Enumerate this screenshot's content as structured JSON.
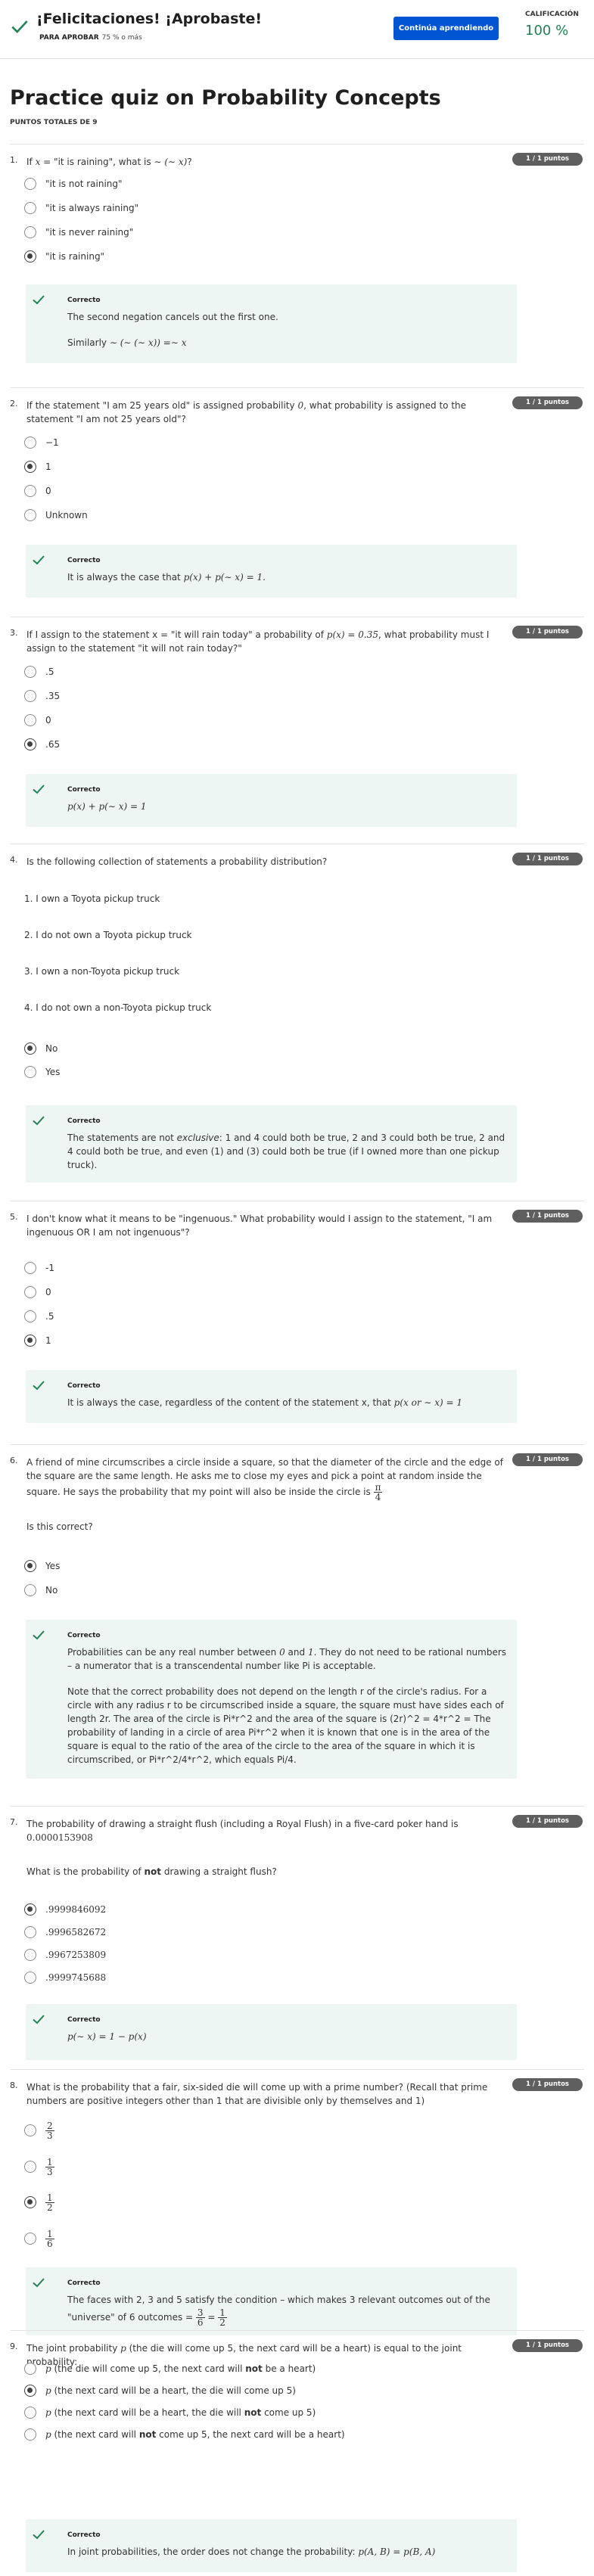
{
  "header": {
    "title": "¡Felicitaciones! ¡Aprobaste!",
    "pass_label": "PARA APROBAR",
    "pass_value": "75 % o más",
    "continue_button": "Continúa aprendiendo",
    "grade_label": "CALIFICACIÓN",
    "grade_value": "100 %"
  },
  "page": {
    "title": "Practice quiz on Probability Concepts",
    "total_points": "PUNTOS TOTALES DE 9"
  },
  "badge": "1 / 1 puntos",
  "correct_label": "Correcto",
  "questions": [
    {
      "number": "1.",
      "parts": [
        "If ",
        "x",
        " = \"it is raining\", what is ",
        "∼ (∼ x)",
        "?"
      ],
      "options": [
        "\"it is not raining\"",
        "\"it is always raining\"",
        "\"it is never raining\"",
        "\"it is raining\""
      ],
      "selected": 3,
      "feedback": "The second negation cancels out the first one.",
      "feedback2_pre": "Similarly",
      "feedback2_math": "∼ (∼ (∼ x)) =∼ x"
    },
    {
      "number": "2.",
      "parts": [
        "If the statement \"I am 25 years old\" is assigned probability ",
        "0",
        ", what probability is assigned to the statement \"I am not 25 years old\"?"
      ],
      "options": [
        "−1",
        "1",
        "0",
        "Unknown"
      ],
      "selected": 1,
      "feedback_pre": "It is always the case that ",
      "feedback_math": "p(x) + p(∼ x) = 1."
    },
    {
      "number": "3.",
      "parts": [
        "If I assign to the statement x = \"it will rain today\" a probability of ",
        "p(x) = 0.35",
        ", what probability must I assign to the statement \"it will not rain today?\""
      ],
      "options": [
        ".5",
        ".35",
        "0",
        ".65"
      ],
      "selected": 3,
      "feedback_math": "p(x) + p(∼ x) = 1"
    },
    {
      "number": "4.",
      "text": "Is the following collection of statements a probability distribution?",
      "statements": [
        "1. I own a Toyota pickup truck",
        "2. I do not own a Toyota pickup truck",
        "3. I own a non-Toyota pickup truck",
        "4. I do not own a non-Toyota pickup truck"
      ],
      "options": [
        "No",
        "Yes"
      ],
      "selected": 0,
      "fb_a": "The statements are not ",
      "fb_em": "exclusive",
      "fb_b": ": 1 and 4 could both be true, 2 and 3 could both be true, 2 and 4 could both be true, and even (1) and (3) could both be true (if I owned more than one pickup truck)."
    },
    {
      "number": "5.",
      "text": "I don't know what it means to be \"ingenuous.\" What probability would I assign to the statement, \"I am ingenuous OR I am not ingenuous\"?",
      "options": [
        "-1",
        "0",
        ".5",
        "1"
      ],
      "selected": 3,
      "feedback_pre": "It is always the case, regardless of the content of the statement x, that ",
      "feedback_math": "p(x or ∼ x) = 1"
    },
    {
      "number": "6.",
      "text": "A friend of mine circumscribes a circle inside a square, so that the diameter of the circle and the edge of the square are the same length. He asks me to close my eyes and pick a point at random inside the square. He says the probability that my point will also be inside the circle is ",
      "frac_n": "π",
      "frac_d": "4",
      "sub": "Is this correct?",
      "options": [
        "Yes",
        "No"
      ],
      "selected": 0,
      "fb1_a": "Probabilities can be any real number between ",
      "fb1_m1": "0",
      "fb1_b": " and ",
      "fb1_m2": "1",
      "fb1_c": ". They do not need to be rational numbers – a numerator that is a transcendental number like Pi is acceptable.",
      "fb2": "Note that the correct probability does not depend on the length r of the circle's radius. For a circle with any radius r to be circumscribed inside a square, the square must have sides each of length 2r. The area of the circle is Pi*r^2 and the area of the square is (2r)^2 = 4*r^2 = The probability of landing in a circle of area Pi*r^2 when it is known that one is in the area of the square is equal to the ratio of the area of the circle to the area of the square in which it is circumscribed, or Pi*r^2/4*r^2, which equals Pi/4."
    },
    {
      "number": "7.",
      "text": "The probability of drawing a straight flush (including a Royal Flush) in a five-card poker hand is",
      "math": "0.0000153908",
      "sub_a": "What is the probability of ",
      "sub_b": "not",
      "sub_c": " drawing a straight flush?",
      "options": [
        ".9999846092",
        ".9996582672",
        ".9967253809",
        ".9999745688"
      ],
      "selected": 0,
      "feedback_math": "p(∼ x) = 1 − p(x)"
    },
    {
      "number": "8.",
      "text": "What is the probability that a fair, six-sided die will come up with a prime number? (Recall that prime numbers are positive integers other than 1 that are divisible only by themselves and 1)",
      "options": [
        {
          "n": "2",
          "d": "3"
        },
        {
          "n": "1",
          "d": "3"
        },
        {
          "n": "1",
          "d": "2"
        },
        {
          "n": "1",
          "d": "6"
        }
      ],
      "selected": 2,
      "fb_a": "The faces with 2, 3 and 5 satisfy the condition – which makes 3 relevant outcomes out of the",
      "fb_b": "\"universe\" of 6 outcomes = ",
      "fb_f1n": "3",
      "fb_f1d": "6",
      "fb_eq": " = ",
      "fb_f2n": "1",
      "fb_f2d": "2"
    },
    {
      "number": "9.",
      "text_a": "The joint probability ",
      "text_m": "p",
      "text_b": " (the die will come up 5, the next card will be a heart) is equal to the joint probability:",
      "options": [
        {
          "p": "p",
          "a": " (the die will come up 5, the next card will ",
          "b": "not",
          "c": " be a heart)"
        },
        {
          "p": "p",
          "a": " (the next card will be a heart, the die will come up 5)",
          "b": "",
          "c": ""
        },
        {
          "p": "p",
          "a": " (the next card will be a heart, the die will ",
          "b": "not",
          "c": " come up 5)"
        },
        {
          "p": "p",
          "a": " (the next card will ",
          "b": "not",
          "c": " come up 5, the next card will be a heart)"
        }
      ],
      "selected": 1,
      "feedback_pre": "In joint probabilities, the order does not change the probability: ",
      "feedback_math": "p(A, B) = p(B, A)"
    }
  ],
  "colors": {
    "accent": "#0056d2",
    "success": "#1f8354",
    "feedback_bg": "#eef6f3",
    "badge": "#5f5f5f"
  },
  "icons": {
    "header": "check-icon",
    "feedback": "check-icon"
  }
}
